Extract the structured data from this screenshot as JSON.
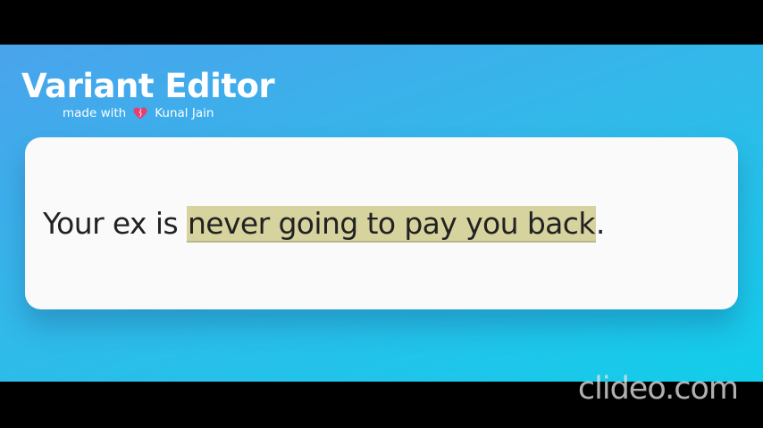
{
  "app": {
    "title": "Variant Editor",
    "credit_prefix": "made with",
    "credit_icon": "heart-icon",
    "credit_author": "Kunal Jain"
  },
  "editor": {
    "text_before": "Your ex is ",
    "highlighted_text": "never going to pay you back",
    "text_after": "."
  },
  "watermark": {
    "text": "clideo.com"
  },
  "colors": {
    "background_gradient": [
      "#4aa3ec",
      "#33b8ea",
      "#12cdea"
    ],
    "card": "#fafafa",
    "highlight": "#d6d39f",
    "heart": "#e83f6f",
    "letterbox": "#000000"
  }
}
